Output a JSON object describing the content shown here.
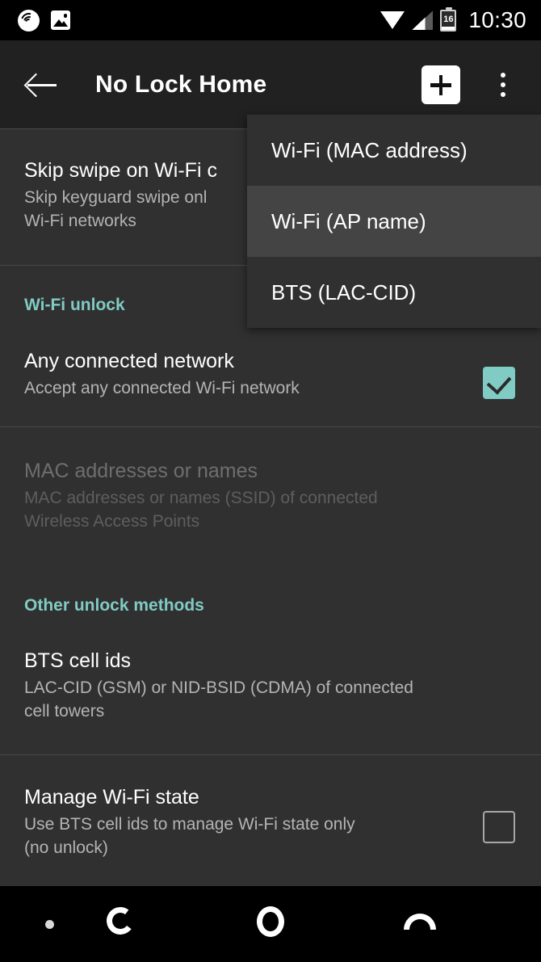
{
  "status_bar": {
    "notification_icons": [
      "spotify-icon",
      "photo-icon"
    ],
    "wifi_icon": "wifi-icon",
    "signal_icon": "cell-signal-icon",
    "battery_icon": "battery-icon",
    "battery_level": "16",
    "clock": "10:30"
  },
  "app_bar": {
    "back_label": "back-arrow",
    "title": "No Lock Home",
    "add_label": "+",
    "overflow_label": "overflow-menu"
  },
  "popup_menu": {
    "items": [
      {
        "label": "Wi-Fi (MAC address)",
        "highlighted": false
      },
      {
        "label": "Wi-Fi (AP name)",
        "highlighted": true
      },
      {
        "label": "BTS (LAC-CID)",
        "highlighted": false
      }
    ]
  },
  "settings": {
    "skip_swipe": {
      "title": "Skip swipe on Wi-Fi c",
      "summary_line1": "Skip keyguard swipe onl",
      "summary_line2": "Wi-Fi networks"
    },
    "wifi_unlock_header": "Wi-Fi unlock",
    "any_connected_network": {
      "title": "Any connected network",
      "summary": "Accept any connected Wi-Fi network",
      "checkbox_state": "checked"
    },
    "mac_addresses": {
      "title": "MAC addresses or names",
      "summary_line1": "MAC addresses or names (SSID) of connected",
      "summary_line2": "Wireless Access Points",
      "enabled": "false"
    },
    "other_unlock_header": "Other unlock methods",
    "bts_cell_ids": {
      "title": "BTS cell ids",
      "summary_line1": "LAC-CID (GSM) or NID-BSID (CDMA) of connected",
      "summary_line2": "cell towers"
    },
    "manage_wifi_state": {
      "title": "Manage Wi-Fi state",
      "summary_line1": "Use BTS cell ids to manage Wi-Fi state only",
      "summary_line2": "(no unlock)",
      "checkbox_state": "unchecked"
    }
  },
  "nav_bar": {
    "back": "back-nav-icon",
    "home": "home-nav-icon",
    "recents": "recents-nav-icon"
  },
  "colors": {
    "accent": "#80cbc4",
    "background": "#303030",
    "app_bar": "#212121",
    "menu_highlight": "#444444"
  }
}
